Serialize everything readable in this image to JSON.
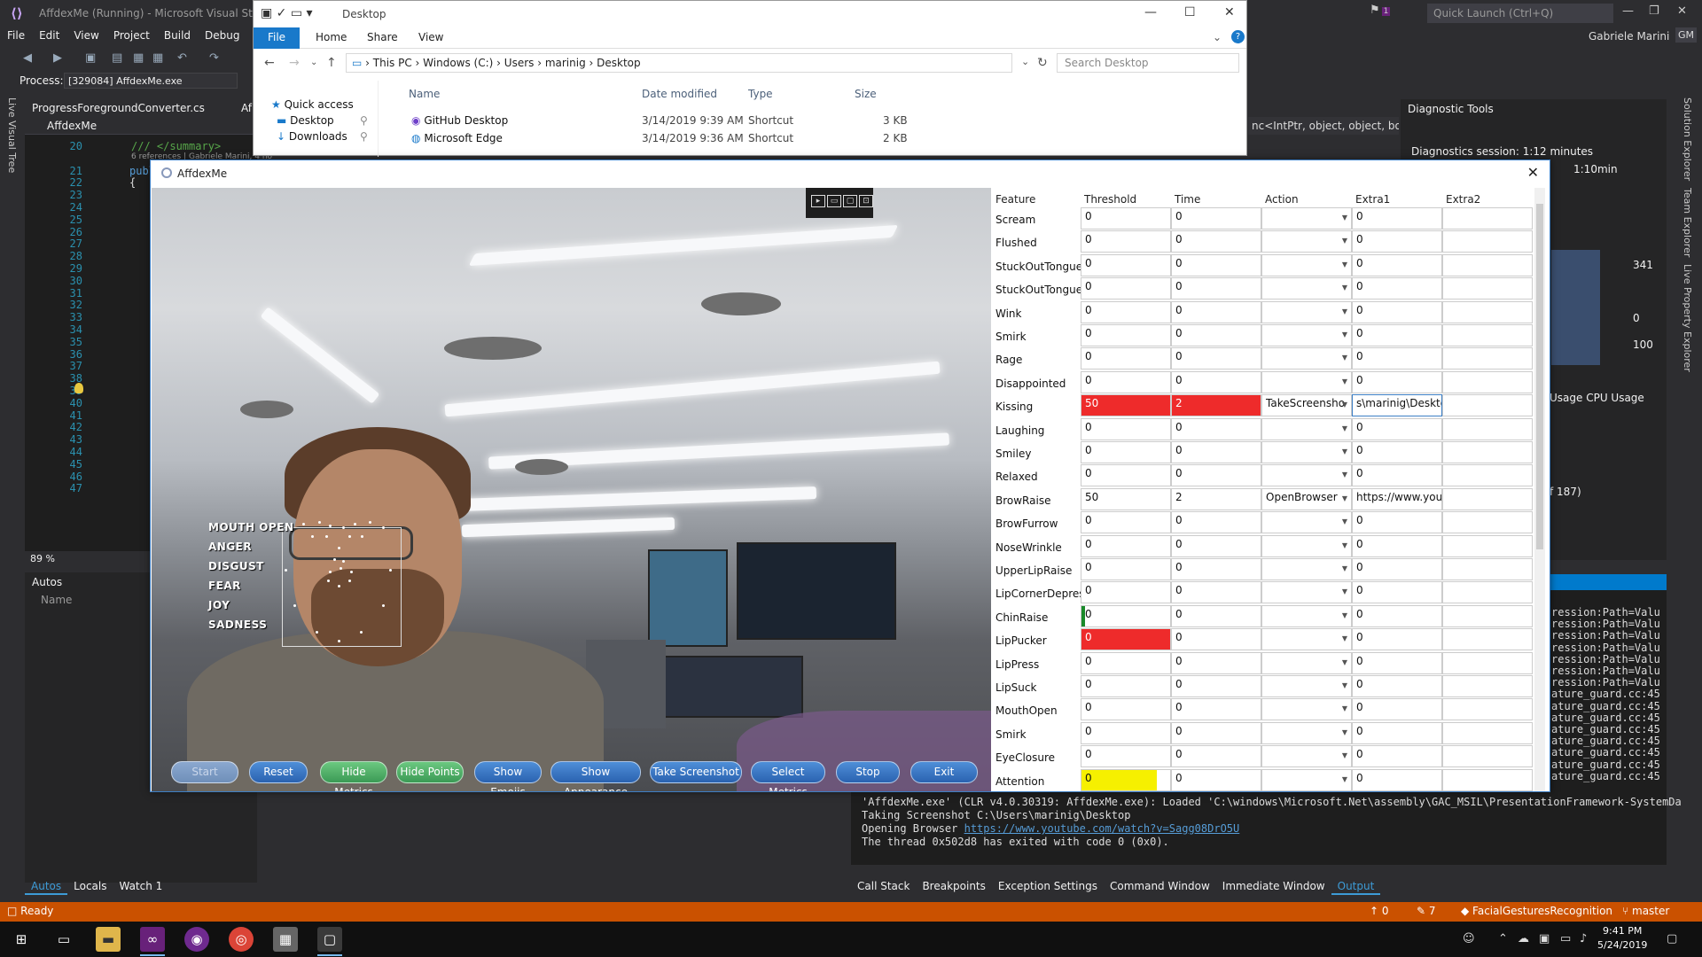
{
  "vs": {
    "title": "AffdexMe (Running) - Microsoft Visual Studio",
    "quick_launch": "Quick Launch (Ctrl+Q)",
    "user": "Gabriele Marini",
    "user_initials": "GM",
    "notification_count": "1",
    "menu": [
      "File",
      "Edit",
      "View",
      "Project",
      "Build",
      "Debug"
    ],
    "process_label": "Process:",
    "process_value": "[329084] AffdexMe.exe",
    "left_vertical_tab": "Live Visual Tree",
    "doc_tab": "ProgressForegroundConverter.cs",
    "doc_tab2": "Af",
    "nav_project": "AffdexMe",
    "code_lines": [
      {
        "num": "20",
        "text": "/// </summary>",
        "kind": "comment"
      },
      {
        "num": "",
        "text": "6 references | Gabriele Marini, 4 ho",
        "kind": "hint"
      },
      {
        "num": "21",
        "text": "publ",
        "kind": "kw"
      },
      {
        "num": "22",
        "text": "{",
        "kind": "plain"
      },
      {
        "num": "23",
        "text": "",
        "kind": "plain"
      },
      {
        "num": "24",
        "text": "",
        "kind": "plain"
      },
      {
        "num": "25",
        "text": "",
        "kind": "plain"
      },
      {
        "num": "26",
        "text": "",
        "kind": "plain"
      },
      {
        "num": "27",
        "text": "",
        "kind": "plain"
      },
      {
        "num": "28",
        "text": "",
        "kind": "plain"
      },
      {
        "num": "29",
        "text": "",
        "kind": "plain"
      },
      {
        "num": "30",
        "text": "",
        "kind": "plain"
      },
      {
        "num": "31",
        "text": "",
        "kind": "plain"
      },
      {
        "num": "32",
        "text": "",
        "kind": "plain"
      },
      {
        "num": "33",
        "text": "",
        "kind": "plain"
      },
      {
        "num": "34",
        "text": "",
        "kind": "plain"
      },
      {
        "num": "35",
        "text": "",
        "kind": "plain"
      },
      {
        "num": "36",
        "text": "",
        "kind": "plain"
      },
      {
        "num": "37",
        "text": "",
        "kind": "plain"
      },
      {
        "num": "38",
        "text": "",
        "kind": "plain"
      },
      {
        "num": "39",
        "text": "",
        "kind": "plain"
      },
      {
        "num": "40",
        "text": "",
        "kind": "plain"
      },
      {
        "num": "41",
        "text": "",
        "kind": "plain"
      },
      {
        "num": "42",
        "text": "",
        "kind": "plain"
      },
      {
        "num": "43",
        "text": "",
        "kind": "plain"
      },
      {
        "num": "44",
        "text": "",
        "kind": "plain"
      },
      {
        "num": "45",
        "text": "",
        "kind": "plain"
      },
      {
        "num": "46",
        "text": "",
        "kind": "plain"
      },
      {
        "num": "47",
        "text": "",
        "kind": "plain"
      }
    ],
    "zoom": "89 %",
    "autos_title": "Autos",
    "autos_col": "Name",
    "bottom_tabs_left": [
      "Autos",
      "Locals",
      "Watch 1"
    ],
    "code_header_right": "nc<IntPtr, object, object, boo",
    "diag": {
      "title": "Diagnostic Tools",
      "session": "Diagnostics session: 1:12 minutes",
      "time": "1:10min",
      "val1": "341",
      "val2": "0",
      "val3": "100",
      "tabs": "Usage   CPU Usage",
      "note": "f 187)"
    },
    "right_vertical_tabs": [
      "Solution Explorer",
      "Team Explorer",
      "Live Property Explorer"
    ],
    "output_right_lines": [
      "ression:Path=Valu",
      "ression:Path=Valu",
      "ression:Path=Valu",
      "ression:Path=Valu",
      "ression:Path=Valu",
      "ression:Path=Valu",
      "ression:Path=Valu",
      "ature_guard.cc:45",
      "ature_guard.cc:45",
      "ature_guard.cc:45",
      "ature_guard.cc:45",
      "ature_guard.cc:45",
      "ature_guard.cc:45",
      "ature_guard.cc:45",
      "ature_guard.cc:45"
    ],
    "output_lines": [
      "'AffdexMe.exe' (CLR v4.0.30319: AffdexMe.exe): Loaded 'C:\\windows\\Microsoft.Net\\assembly\\GAC_MSIL\\PresentationFramework-SystemDa",
      "Taking Screenshot C:\\Users\\marinig\\Desktop",
      "The thread 0x502d8 has exited with code 0 (0x0)."
    ],
    "output_browser_prefix": "Opening Browser ",
    "output_browser_link": "https://www.youtube.com/watch?v=Sagg08DrO5U",
    "bottom_tabs_right": [
      "Call Stack",
      "Breakpoints",
      "Exception Settings",
      "Command Window",
      "Immediate Window",
      "Output"
    ],
    "status": {
      "ready": "Ready",
      "up": "0",
      "pencil": "7",
      "repo": "FacialGesturesRecognition",
      "branch": "master"
    }
  },
  "explorer": {
    "title": "Desktop",
    "tabs": [
      "File",
      "Home",
      "Share",
      "View"
    ],
    "path": [
      "This PC",
      "Windows (C:)",
      "Users",
      "marinig",
      "Desktop"
    ],
    "search": "Search Desktop",
    "nav": [
      "Quick access",
      "Desktop",
      "Downloads"
    ],
    "columns": [
      "Name",
      "Date modified",
      "Type",
      "Size"
    ],
    "files": [
      {
        "name": "GitHub Desktop",
        "date": "3/14/2019 9:39 AM",
        "type": "Shortcut",
        "size": "3 KB"
      },
      {
        "name": "Microsoft Edge",
        "date": "3/14/2019 9:36 AM",
        "type": "Shortcut",
        "size": "2 KB"
      }
    ]
  },
  "affdex": {
    "title": "AffdexMe",
    "metrics": [
      "MOUTH OPEN",
      "ANGER",
      "DISGUST",
      "FEAR",
      "JOY",
      "SADNESS"
    ],
    "buttons": [
      "Start",
      "Reset",
      "Hide Metrics",
      "Hide Points",
      "Show Emojis",
      "Show Appearance",
      "Take Screenshot",
      "Select Metrics",
      "Stop",
      "Exit"
    ],
    "columns": [
      "Feature",
      "Threshold",
      "Time",
      "Action",
      "Extra1",
      "Extra2"
    ],
    "rows": [
      {
        "feature": "Scream",
        "threshold": "0",
        "time": "0",
        "action": "",
        "extra1": "0",
        "extra2": "",
        "style": ""
      },
      {
        "feature": "Flushed",
        "threshold": "0",
        "time": "0",
        "action": "",
        "extra1": "0",
        "extra2": "",
        "style": ""
      },
      {
        "feature": "StuckOutTongue",
        "threshold": "0",
        "time": "0",
        "action": "",
        "extra1": "0",
        "extra2": "",
        "style": ""
      },
      {
        "feature": "StuckOutTongueW",
        "threshold": "0",
        "time": "0",
        "action": "",
        "extra1": "0",
        "extra2": "",
        "style": ""
      },
      {
        "feature": "Wink",
        "threshold": "0",
        "time": "0",
        "action": "",
        "extra1": "0",
        "extra2": "",
        "style": ""
      },
      {
        "feature": "Smirk",
        "threshold": "0",
        "time": "0",
        "action": "",
        "extra1": "0",
        "extra2": "",
        "style": ""
      },
      {
        "feature": "Rage",
        "threshold": "0",
        "time": "0",
        "action": "",
        "extra1": "0",
        "extra2": "",
        "style": ""
      },
      {
        "feature": "Disappointed",
        "threshold": "0",
        "time": "0",
        "action": "",
        "extra1": "0",
        "extra2": "",
        "style": ""
      },
      {
        "feature": "Kissing",
        "threshold": "50",
        "time": "2",
        "action": "TakeScreensho",
        "extra1": "s\\marinig\\Desktop",
        "extra2": "",
        "style": "red-both"
      },
      {
        "feature": "Laughing",
        "threshold": "0",
        "time": "0",
        "action": "",
        "extra1": "0",
        "extra2": "",
        "style": ""
      },
      {
        "feature": "Smiley",
        "threshold": "0",
        "time": "0",
        "action": "",
        "extra1": "0",
        "extra2": "",
        "style": ""
      },
      {
        "feature": "Relaxed",
        "threshold": "0",
        "time": "0",
        "action": "",
        "extra1": "0",
        "extra2": "",
        "style": ""
      },
      {
        "feature": "BrowRaise",
        "threshold": "50",
        "time": "2",
        "action": "OpenBrowser",
        "extra1": "https://www.youtu",
        "extra2": "",
        "style": ""
      },
      {
        "feature": "BrowFurrow",
        "threshold": "0",
        "time": "0",
        "action": "",
        "extra1": "0",
        "extra2": "",
        "style": ""
      },
      {
        "feature": "NoseWrinkle",
        "threshold": "0",
        "time": "0",
        "action": "",
        "extra1": "0",
        "extra2": "",
        "style": ""
      },
      {
        "feature": "UpperLipRaise",
        "threshold": "0",
        "time": "0",
        "action": "",
        "extra1": "0",
        "extra2": "",
        "style": ""
      },
      {
        "feature": "LipCornerDepress",
        "threshold": "0",
        "time": "0",
        "action": "",
        "extra1": "0",
        "extra2": "",
        "style": ""
      },
      {
        "feature": "ChinRaise",
        "threshold": "0",
        "time": "0",
        "action": "",
        "extra1": "0",
        "extra2": "",
        "style": "green-thr"
      },
      {
        "feature": "LipPucker",
        "threshold": "0",
        "time": "0",
        "action": "",
        "extra1": "0",
        "extra2": "",
        "style": "red-thr"
      },
      {
        "feature": "LipPress",
        "threshold": "0",
        "time": "0",
        "action": "",
        "extra1": "0",
        "extra2": "",
        "style": ""
      },
      {
        "feature": "LipSuck",
        "threshold": "0",
        "time": "0",
        "action": "",
        "extra1": "0",
        "extra2": "",
        "style": ""
      },
      {
        "feature": "MouthOpen",
        "threshold": "0",
        "time": "0",
        "action": "",
        "extra1": "0",
        "extra2": "",
        "style": ""
      },
      {
        "feature": "Smirk",
        "threshold": "0",
        "time": "0",
        "action": "",
        "extra1": "0",
        "extra2": "",
        "style": ""
      },
      {
        "feature": "EyeClosure",
        "threshold": "0",
        "time": "0",
        "action": "",
        "extra1": "0",
        "extra2": "",
        "style": ""
      },
      {
        "feature": "Attention",
        "threshold": "0",
        "time": "0",
        "action": "",
        "extra1": "0",
        "extra2": "",
        "style": "yellow-thr"
      }
    ]
  },
  "taskbar": {
    "time": "9:41 PM",
    "date": "5/24/2019"
  }
}
